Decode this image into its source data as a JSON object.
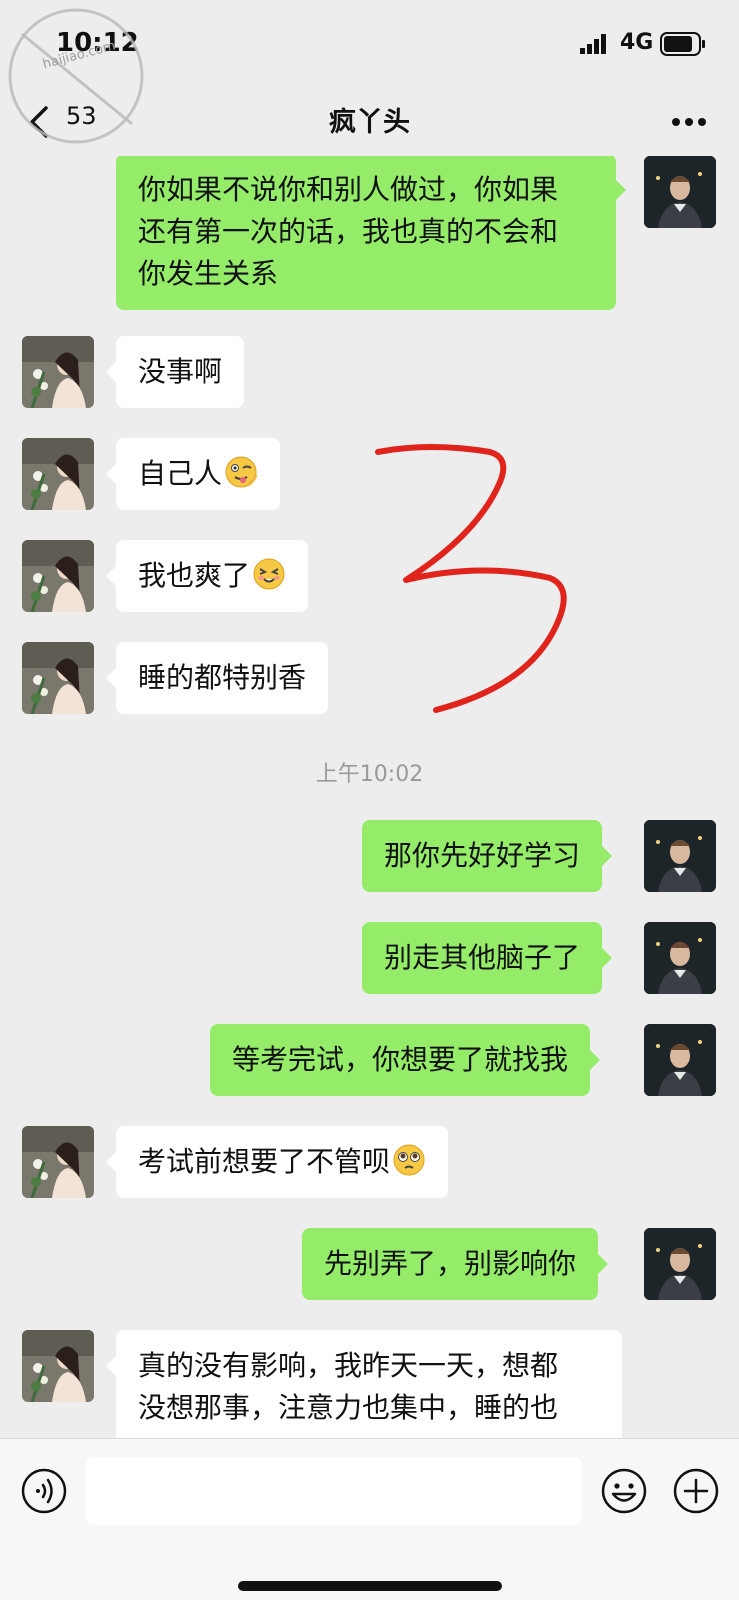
{
  "status_bar": {
    "time": "10:12",
    "network": "4G"
  },
  "watermark": {
    "text": "haijiao.com"
  },
  "nav": {
    "back_count": "53",
    "title": "疯丫头"
  },
  "messages": [
    {
      "side": "right",
      "text": "你如果不说你和别人做过，你如果还有第一次的话，我也真的不会和你发生关系",
      "lines": [
        "你如果不说你和别人做过，你如果",
        "还有第一次的话，我也真的不会和",
        "你发生关系"
      ]
    },
    {
      "side": "left",
      "text": "没事啊"
    },
    {
      "side": "left",
      "text": "自己人",
      "emoji": "wink-tongue"
    },
    {
      "side": "left",
      "text": "我也爽了",
      "emoji": "blush-grin"
    },
    {
      "side": "left",
      "text": "睡的都特别香"
    },
    {
      "side": "right",
      "text": "那你先好好学习"
    },
    {
      "side": "right",
      "text": "别走其他脑子了"
    },
    {
      "side": "right",
      "text": "等考完试，你想要了就找我"
    },
    {
      "side": "left",
      "text": "考试前想要了不管呗",
      "emoji": "pleading"
    },
    {
      "side": "right",
      "text": "先别弄了，别影响你"
    },
    {
      "side": "left",
      "text": "真的没有影响，我昨天一天，想都没想那事，注意力也集中，睡的也",
      "lines": [
        "真的没有影响，我昨天一天，想都",
        "没想那事，注意力也集中，睡的也"
      ]
    }
  ],
  "timestamp": "上午10:02",
  "annotation": {
    "handwritten_mark": "3",
    "color": "#e0231b"
  },
  "input_bar": {
    "placeholder": ""
  },
  "colors": {
    "sent_bubble": "#95ec69",
    "received_bubble": "#ffffff",
    "background": "#ededed"
  }
}
